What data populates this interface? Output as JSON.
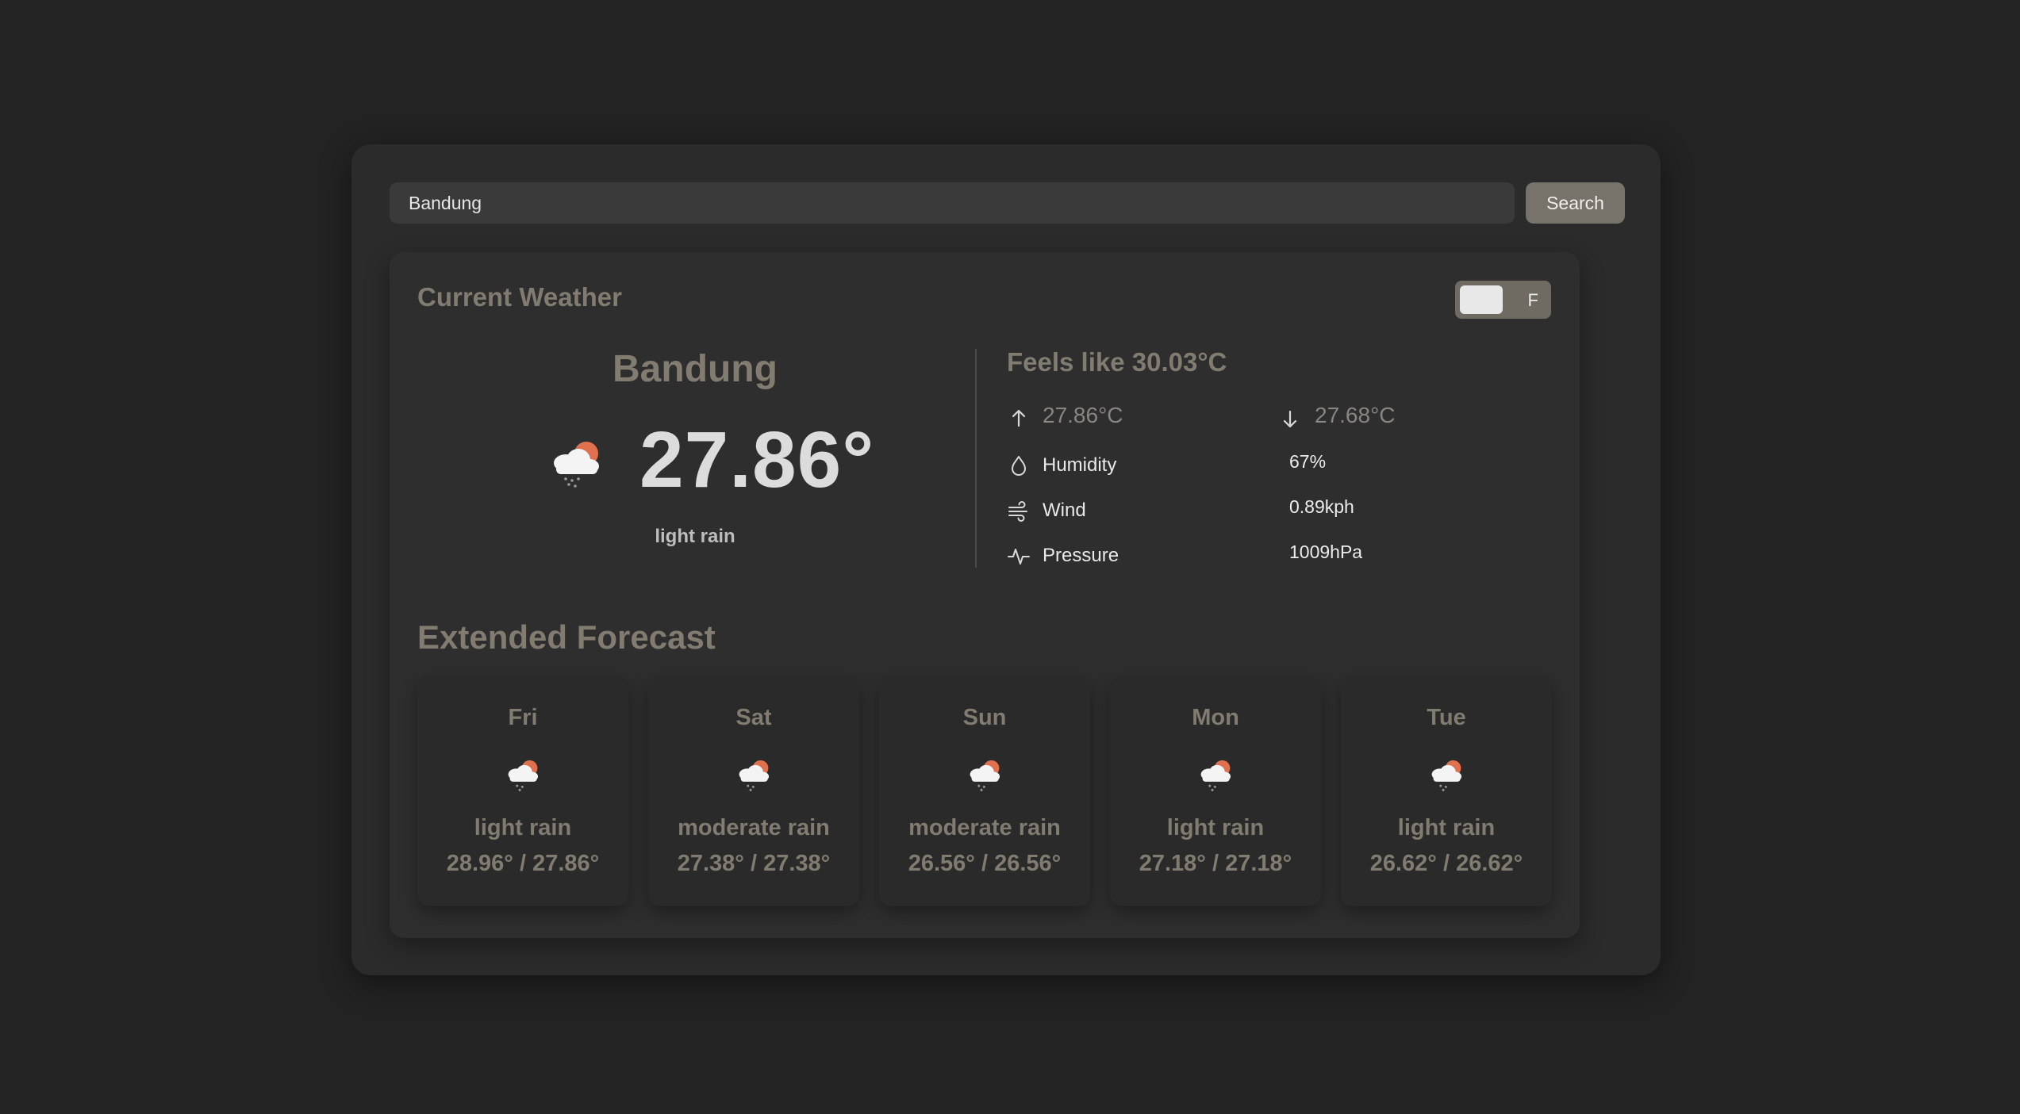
{
  "search": {
    "value": "Bandung",
    "button_label": "Search"
  },
  "current": {
    "section_title": "Current Weather",
    "unit_toggle_label": "F",
    "city": "Bandung",
    "icon": "cloud-rain-sun-icon",
    "temperature": "27.86°",
    "description": "light rain",
    "feels_like": "Feels like 30.03°C",
    "temp_max": "27.86°C",
    "temp_min": "27.68°C",
    "stats": [
      {
        "label": "Humidity",
        "value": "67%",
        "icon": "droplet-icon"
      },
      {
        "label": "Wind",
        "value": "0.89kph",
        "icon": "wind-icon"
      },
      {
        "label": "Pressure",
        "value": "1009hPa",
        "icon": "pulse-icon"
      }
    ]
  },
  "forecast": {
    "title": "Extended Forecast",
    "days": [
      {
        "day": "Fri",
        "description": "light rain",
        "temps": "28.96° / 27.86°",
        "icon": "cloud-rain-sun-icon"
      },
      {
        "day": "Sat",
        "description": "moderate rain",
        "temps": "27.38° / 27.38°",
        "icon": "cloud-rain-sun-icon"
      },
      {
        "day": "Sun",
        "description": "moderate rain",
        "temps": "26.56° / 26.56°",
        "icon": "cloud-rain-sun-icon"
      },
      {
        "day": "Mon",
        "description": "light rain",
        "temps": "27.18° / 27.18°",
        "icon": "cloud-rain-sun-icon"
      },
      {
        "day": "Tue",
        "description": "light rain",
        "temps": "26.62° / 26.62°",
        "icon": "cloud-rain-sun-icon"
      }
    ]
  },
  "colors": {
    "background": "#232323",
    "panel": "#2b2b2b",
    "accent": "#827b70",
    "sun": "#e0714f"
  }
}
